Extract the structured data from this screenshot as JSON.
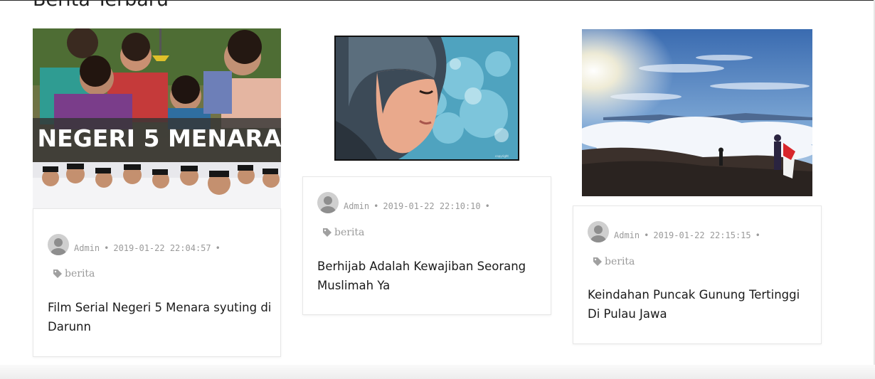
{
  "section": {
    "title": "Berita Terbaru"
  },
  "posts": [
    {
      "image_alt": "Negeri 5 Menara poster",
      "overlay_text": "NEGERI 5 MENARA",
      "author": "Admin",
      "date": "2019-01-22 22:04:57",
      "category": "berita",
      "title": "Film Serial Negeri 5 Menara syuting di Darunn"
    },
    {
      "image_alt": "Illustration of a woman wearing hijab",
      "author": "Admin",
      "date": "2019-01-22 22:10:10",
      "category": "berita",
      "title": "Berhijab Adalah Kewajiban Seorang Muslimah Ya"
    },
    {
      "image_alt": "Sea of clouds from a mountain summit",
      "author": "Admin",
      "date": "2019-01-22 22:15:15",
      "category": "berita",
      "title": "Keindahan Puncak Gunung Tertinggi Di Pulau Jawa"
    }
  ],
  "colors": {
    "meta_text": "#9a9a9a",
    "card_border": "#e7e7e7",
    "title_text": "#1a1a1a"
  },
  "icons": {
    "avatar": "user-avatar-icon",
    "category": "tag-icon"
  }
}
